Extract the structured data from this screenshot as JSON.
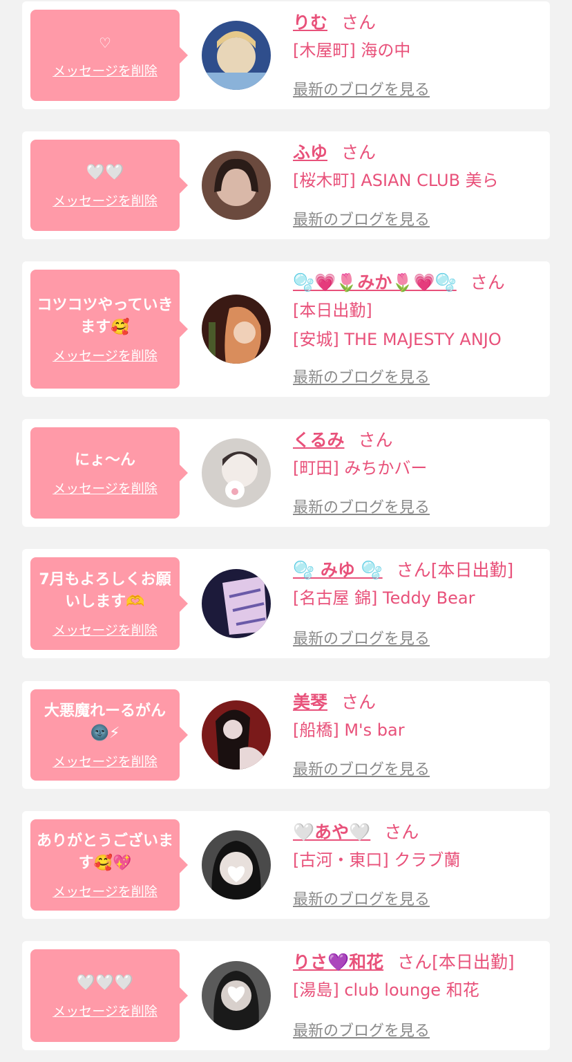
{
  "delete_label": "メッセージを削除",
  "blog_label": "最新のブログを見る",
  "san_label": "さん",
  "colors": {
    "background": "#f2f2f2",
    "card": "#ffffff",
    "bubble": "#ff9aa8",
    "accent": "#e8517a",
    "blog_link": "#8a8a8a"
  },
  "entries": [
    {
      "message": "♡",
      "name": "りむ",
      "status": "",
      "shop": "[木屋町] 海の中",
      "avatar_colors": [
        "#2f4e8c",
        "#8ab2d9",
        "#e8d6b8"
      ]
    },
    {
      "message": "🤍🤍",
      "name": "ふゆ",
      "status": "",
      "shop": "[桜木町] ASIAN CLUB 美ら",
      "avatar_colors": [
        "#2a1c18",
        "#6b4a3e",
        "#d9b8a8"
      ]
    },
    {
      "message": "コツコツやっていきます🥰",
      "name": "🫧💗🌷みか🌷💗🫧",
      "status": "",
      "status_line": "[本日出勤]",
      "shop": "[安城] THE MAJESTY ANJO",
      "avatar_colors": [
        "#3a1a14",
        "#8a4b2e",
        "#d98d5c"
      ]
    },
    {
      "message": "にょ〜ん",
      "name": "くるみ",
      "status": "",
      "shop": "[町田] みちかバー",
      "avatar_colors": [
        "#9a9a9a",
        "#d4d0cc",
        "#f2ece8"
      ]
    },
    {
      "message": "7月もよろしくお願いします🫶",
      "name": "🫧 みゆ 🫧",
      "status": "[本日出勤]",
      "shop": "[名古屋 錦] Teddy Bear",
      "avatar_colors": [
        "#1c1a3a",
        "#6a5aa8",
        "#e0c8e8"
      ]
    },
    {
      "message": "大悪魔れーるがん🌚⚡",
      "name": "美琴",
      "status": "",
      "shop": "[船橋] M's bar",
      "avatar_colors": [
        "#1a1010",
        "#7a1a1a",
        "#e8d8d8"
      ]
    },
    {
      "message": "ありがとうございます🥰💖",
      "name": "🤍あや🤍",
      "status": "",
      "shop": "[古河・東口] クラブ蘭",
      "avatar_colors": [
        "#121212",
        "#4a4a4a",
        "#e8e0dc"
      ]
    },
    {
      "message": "🤍🤍🤍",
      "name": "りさ💜和花",
      "status": "[本日出勤]",
      "shop": "[湯島] club lounge 和花",
      "avatar_colors": [
        "#1a1a1a",
        "#5a5a5a",
        "#d8d0cc"
      ]
    }
  ]
}
